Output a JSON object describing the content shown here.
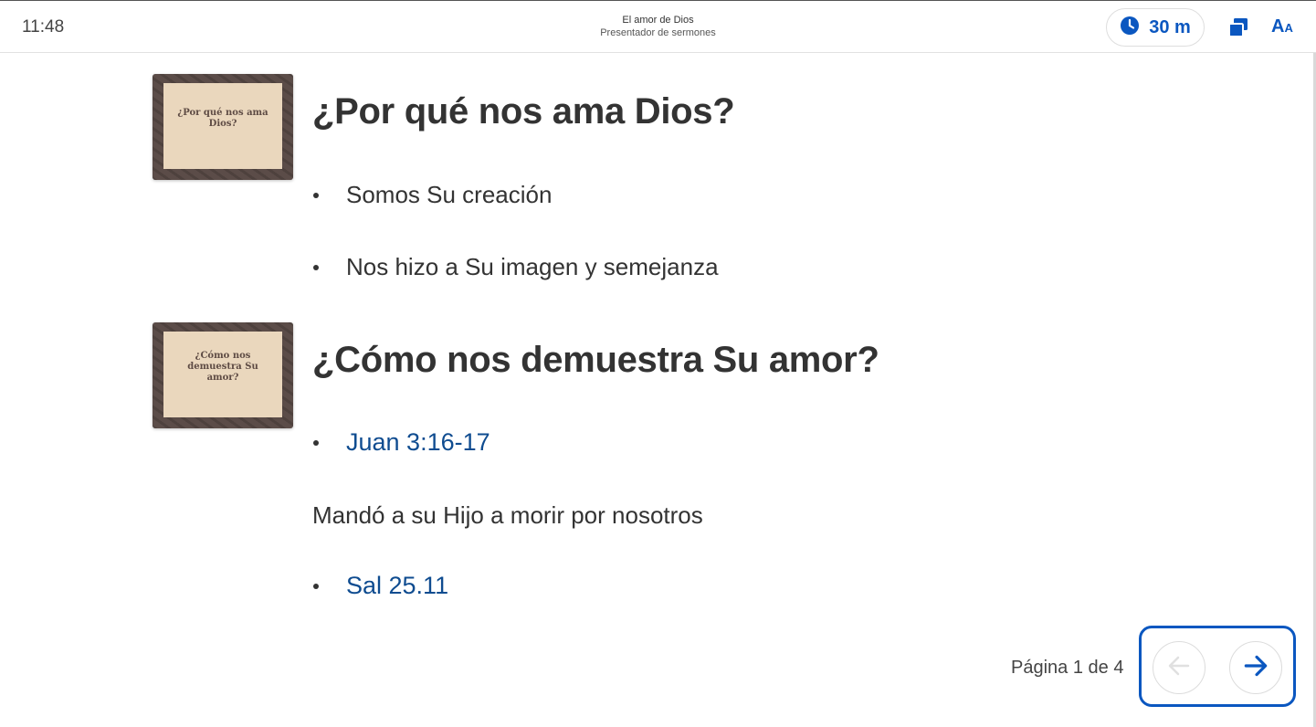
{
  "header": {
    "clock": "11:48",
    "title": "El amor de Dios",
    "subtitle": "Presentador de sermones",
    "timer_label": "30 m",
    "font_big": "A",
    "font_small": "A"
  },
  "slides": [
    {
      "thumb_text": "¿Por qué nos ama Dios?",
      "heading": "¿Por qué nos ama Dios?",
      "bullets": [
        "Somos Su creación",
        "Nos hizo a Su imagen y semejanza"
      ]
    },
    {
      "thumb_text": "¿Cómo nos demuestra Su amor?",
      "heading": "¿Cómo nos demuestra Su amor?",
      "link1": "Juan 3:16-17",
      "paragraph": "Mandó a su Hijo a morir por nosotros",
      "link2": "Sal 25.11"
    }
  ],
  "pagination": {
    "label": "Página 1 de 4"
  },
  "colors": {
    "accent": "#0b57c0",
    "link": "#0f4c90",
    "text": "#333333"
  },
  "icons": {
    "timer": "clock-icon",
    "copy": "copy-icon",
    "font": "font-size-icon",
    "prev": "arrow-left-icon",
    "next": "arrow-right-icon"
  }
}
